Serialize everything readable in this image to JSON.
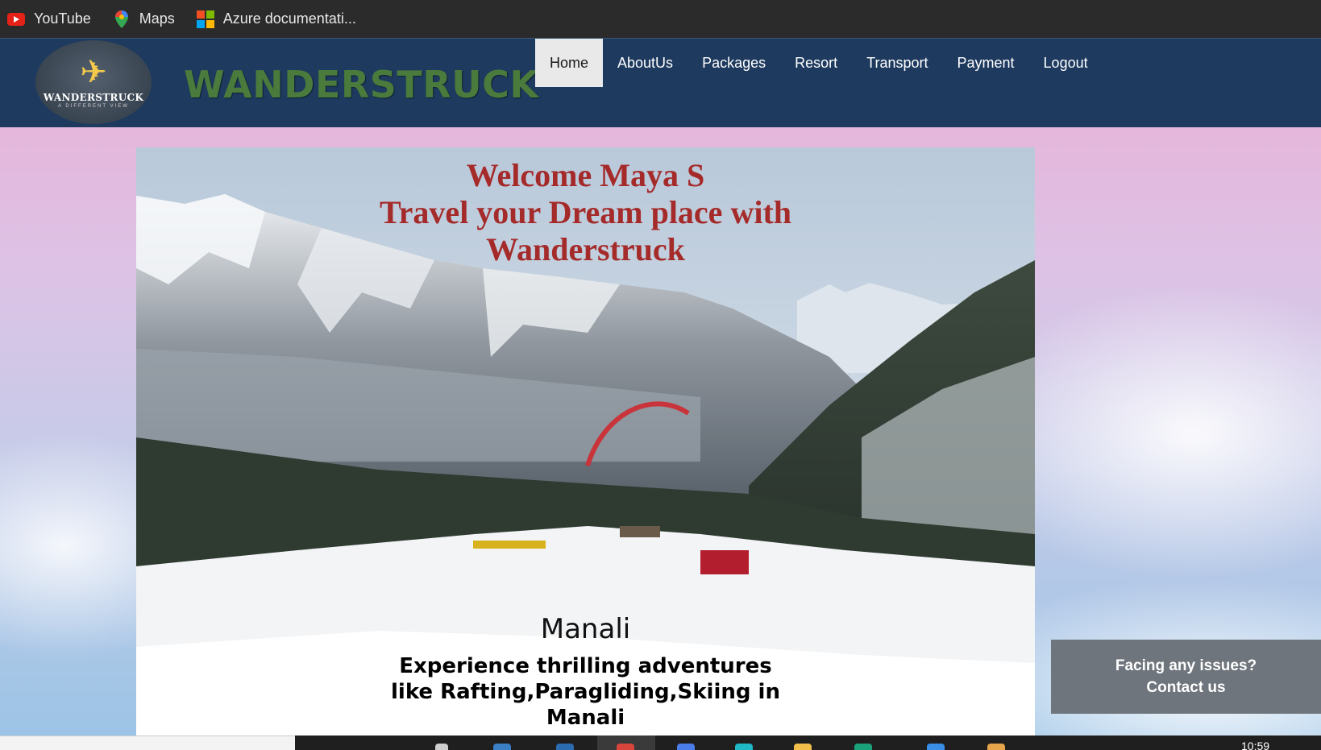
{
  "bookmarks": [
    {
      "label": "YouTube",
      "icon": "youtube-icon"
    },
    {
      "label": "Maps",
      "icon": "maps-pin-icon"
    },
    {
      "label": "Azure documentati...",
      "icon": "microsoft-icon"
    }
  ],
  "header": {
    "logo_text": "WANDERSTRUCK",
    "logo_subtext": "A DIFFERENT VIEW",
    "brand": "WANDERSTRUCK"
  },
  "nav": [
    {
      "label": "Home",
      "active": true
    },
    {
      "label": "AboutUs",
      "active": false
    },
    {
      "label": "Packages",
      "active": false
    },
    {
      "label": "Resort",
      "active": false
    },
    {
      "label": "Transport",
      "active": false
    },
    {
      "label": "Payment",
      "active": false
    },
    {
      "label": "Logout",
      "active": false
    }
  ],
  "hero": {
    "welcome_line1": "Welcome Maya S",
    "welcome_line2": "Travel your Dream place with Wanderstruck",
    "place": "Manali",
    "tagline": "Experience thrilling adventures like Rafting,Paragliding,Skiing in Manali"
  },
  "contact": {
    "line1": "Facing any issues?",
    "line2": "Contact us"
  },
  "taskbar": {
    "clock": "10:59"
  },
  "colors": {
    "header_bg": "#1e3a5f",
    "brand_green": "#4a7a3c",
    "welcome_red": "#a52a2a",
    "contact_bg": "#6e757c"
  }
}
